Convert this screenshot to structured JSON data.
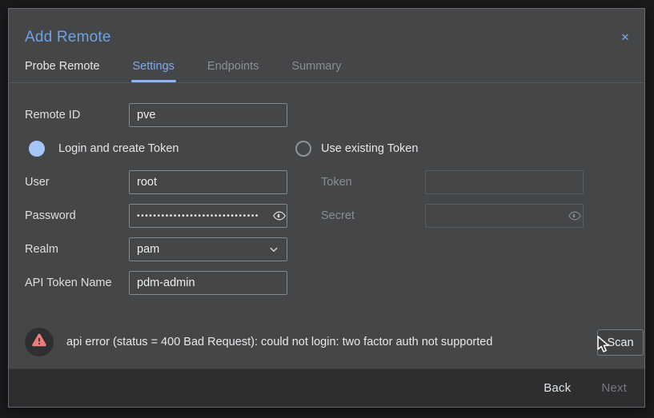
{
  "dialog": {
    "title": "Add Remote",
    "close_icon": "✕",
    "tabs": [
      {
        "label": "Probe Remote",
        "state": "normal"
      },
      {
        "label": "Settings",
        "state": "active"
      },
      {
        "label": "Endpoints",
        "state": "disabled"
      },
      {
        "label": "Summary",
        "state": "disabled"
      }
    ]
  },
  "form": {
    "remote_id": {
      "label": "Remote ID",
      "value": "pve"
    },
    "auth_mode": {
      "login_create": {
        "label": "Login and create Token",
        "selected": true
      },
      "use_existing": {
        "label": "Use existing Token",
        "selected": false
      }
    },
    "user": {
      "label": "User",
      "value": "root"
    },
    "token": {
      "label": "Token",
      "value": "",
      "disabled": true
    },
    "password": {
      "label": "Password",
      "masked_value": "••••••••••••••••••••••••••••••"
    },
    "secret": {
      "label": "Secret",
      "value": "",
      "disabled": true
    },
    "realm": {
      "label": "Realm",
      "value": "pam"
    },
    "api_token_name": {
      "label": "API Token Name",
      "value": "pdm-admin"
    }
  },
  "status": {
    "error_message": "api error (status = 400 Bad Request): could not login: two factor auth not supported",
    "scan_button_label": "Scan"
  },
  "footer": {
    "back_label": "Back",
    "next_label": "Next"
  },
  "colors": {
    "accent_blue": "#6ea2e8",
    "tab_underline": "#8ab4f8",
    "radio_selected": "#a6c6f6",
    "error_red": "#ed7d7d",
    "modal_bg": "#454647",
    "footer_bg": "#2c2e30"
  }
}
